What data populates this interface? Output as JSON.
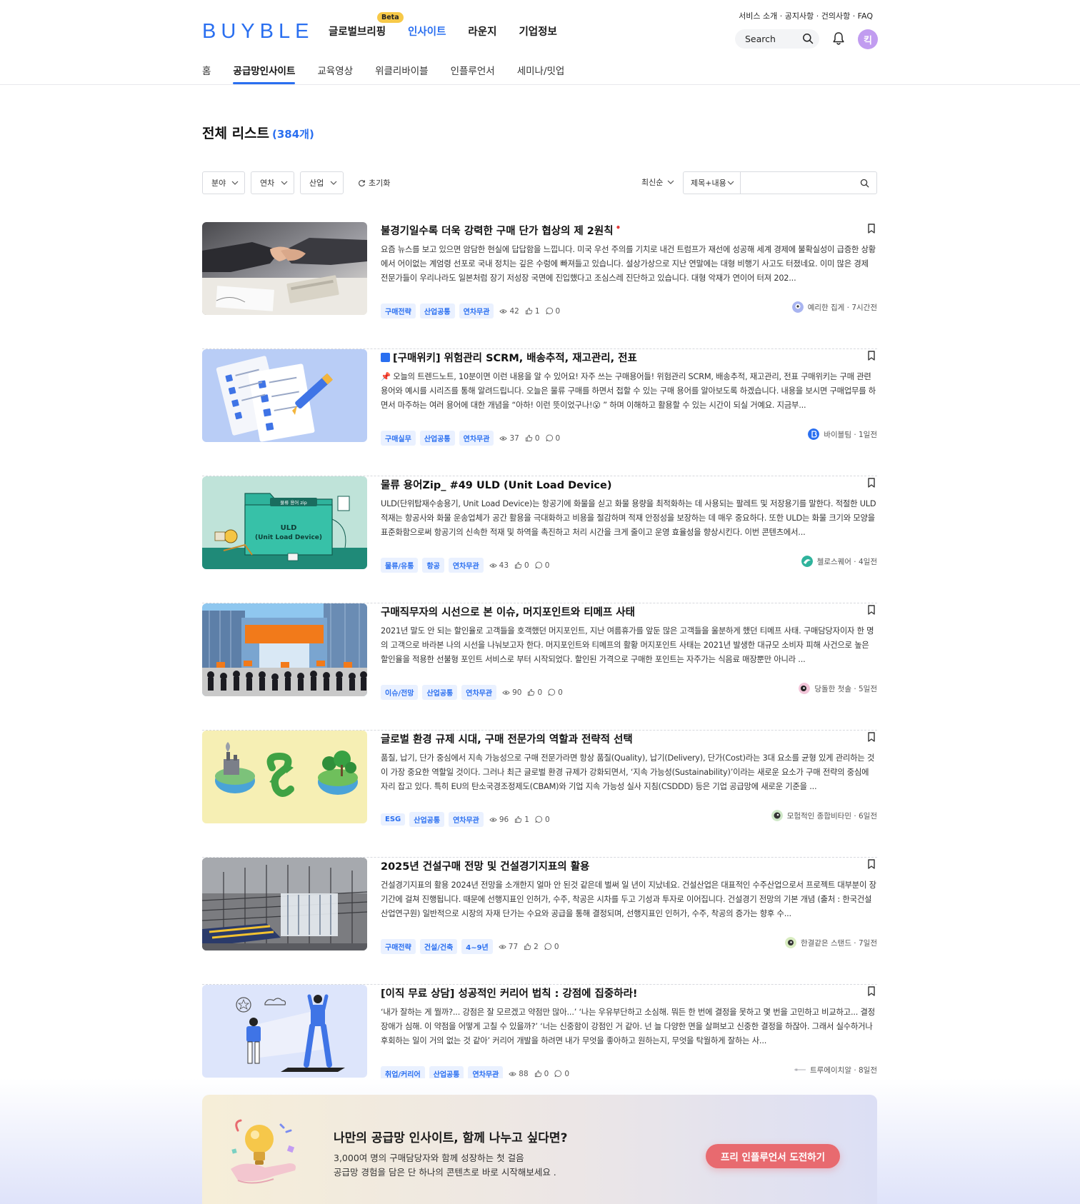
{
  "header": {
    "logo": "BUYBLE",
    "nav": [
      {
        "label": "글로벌브리핑",
        "badge": "Beta"
      },
      {
        "label": "인사이트",
        "active": true
      },
      {
        "label": "라운지"
      },
      {
        "label": "기업정보"
      }
    ],
    "util_links": "서비스 소개 · 공지사항 · 건의사항 · FAQ",
    "search_label": "Search",
    "avatar_initial": "킥",
    "subnav": [
      {
        "label": "홈"
      },
      {
        "label": "공급망인사이트",
        "active": true
      },
      {
        "label": "교육영상"
      },
      {
        "label": "위클리바이블"
      },
      {
        "label": "인플루언서"
      },
      {
        "label": "세미나/밋업"
      }
    ]
  },
  "list": {
    "title": "전체 리스트",
    "count": "(384개)"
  },
  "filters": {
    "field": "분야",
    "year": "연차",
    "industry": "산업",
    "reset": "초기화",
    "sort": "최신순",
    "scope": "제목+내용",
    "query_value": ""
  },
  "articles": [
    {
      "title": "불경기일수록 더욱 강력한 구매 단가 협상의 제 2원칙",
      "is_new": true,
      "new_mark": "•",
      "excerpt": "요즘 뉴스를 보고 있으면 암담한 현실에 답답함을 느낍니다. 미국 우선 주의를 기치로 내건 트럼프가 재선에 성공해 세계 경제에 불확실성이 급증한 상황에서 어이없는 계엄령 선포로 국내 정치는 깊은 수렁에 빠져들고 있습니다. 설상가상으로 지난 연말에는 대형 비행기 사고도 터졌네요. 이미 많은 경제 전문가들이 우리나라도 일본처럼 장기 저성장 국면에 진입했다고 조심스레 진단하고 있습니다. 대형 악재가 연이어 터져 202...",
      "tags": [
        "구매전략",
        "산업공통",
        "연차무관"
      ],
      "views": "42",
      "likes": "1",
      "comments": "0",
      "author": "예리한 집게 · 7시간전",
      "thumb": "handshake"
    },
    {
      "title": "[구매위키] 위험관리 SCRM, 배송추적, 재고관리, 전표",
      "book_icon": true,
      "excerpt": "📌 오늘의 트렌드노트, 10분이면 이런 내용을 알 수 있어요! 자주 쓰는 구매용어들! 위험관리 SCRM, 배송추적, 재고관리, 전표 구매위키는 구매 관련 용어와 예시를 시리즈를 통해 알려드립니다. 오늘은 물류 구매를 하면서 접할 수 있는 구매 용어를 알아보도록 하겠습니다. 내용을 보시면 구매업무를 하면서 마주하는 여러 용어에 대한 개념을 “아하! 이런 뜻이었구나!😮 ” 하며 이해하고 활용할 수 있는 시간이 되실 거예요. 지금부...",
      "tags": [
        "구매실무",
        "산업공통",
        "연차무관"
      ],
      "views": "37",
      "likes": "0",
      "comments": "0",
      "author": "바이블팀 · 1일전",
      "thumb": "checklist"
    },
    {
      "title": "물류 용어Zip_ #49 ULD (Unit Load Device)",
      "excerpt": "ULD(단위탑재수송용기, Unit Load Device)는 항공기에 화물을 싣고 화물 용량을 최적화하는 데 사용되는 팔레트 및 저장용기를 말한다. 적절한 ULD 적재는 항공사와 화물 운송업체가 공간 활용을 극대화하고 비용을 절감하며 적재 안정성을 보장하는 데 매우 중요하다. 또한 ULD는 화물 크기와 모양을 표준화함으로써 항공기의 신속한 적재 및 하역을 촉진하고 처리 시간을 크게 줄이고 운영 효율성을 향상시킨다. 이번 콘텐츠에서...",
      "tags": [
        "물류/유통",
        "항공",
        "연차무관"
      ],
      "views": "43",
      "likes": "0",
      "comments": "0",
      "author": "첼로스퀘어 · 4일전",
      "thumb": "uld",
      "thumb_text": [
        "ULD",
        "(Unit Load Device)"
      ],
      "thumb_folder_label": "물류 용어 zip"
    },
    {
      "title": "구매직무자의 시선으로 본 이슈, 머지포인트와 티메프 사태",
      "excerpt": "2021년 말도 안 되는 할인율로 고객들을 호객했던 머지포인트, 지난 여름휴가를 앞둔 많은 고객들을 울분하게 했던 티메프 사태. 구매담당자이자 한 명의 고객으로 바라본 나의 시선을 나눠보고자 한다. 머지포인트와 티메프의 활황 머지포인트 사태는 2021년 발생한 대규모 소비자 피해 사건으로 높은 할인율을 적용한 선불형 포인트 서비스로 부터 시작되었다. 할인된 가격으로 구매한 포인트는 자주가는 식음료 매장뿐만 아니라 ...",
      "tags": [
        "이슈/전망",
        "산업공통",
        "연차무관"
      ],
      "views": "90",
      "likes": "0",
      "comments": "0",
      "author": "당돌한 첫솔 · 5일전",
      "thumb": "crowd"
    },
    {
      "title": "글로벌 환경 규제 시대, 구매 전문가의 역할과 전략적 선택",
      "excerpt": "품질, 납기, 단가 중심에서 지속 가능성으로 구매 전문가라면 항상 품질(Quality), 납기(Delivery), 단가(Cost)라는 3대 요소를 균형 있게 관리하는 것이 가장 중요한 역할일 것이다. 그러나 최근 글로벌 환경 규제가 강화되면서, ‘지속 가능성(Sustainability)’이라는 새로운 요소가 구매 전략의 중심에 자리 잡고 있다. 특히 EU의 탄소국경조정제도(CBAM)와 기업 지속 가능성 실사 지침(CSDDD) 등은 기업 공급망에 새로운 기준을 ...",
      "tags": [
        "ESG",
        "산업공통",
        "연차무관"
      ],
      "views": "96",
      "likes": "1",
      "comments": "0",
      "author": "모험적인 종합비타민 · 6일전",
      "thumb": "eco"
    },
    {
      "title": "2025년 건설구매 전망 및 건설경기지표의 활용",
      "excerpt": "건설경기지표의 활용 2024년 전망을 소개한지 얼마 안 된것 같은데 벌써 일 년이 지났네요. 건설산업은 대표적인 수주산업으로서 프로젝트 대부분이 장기간에 걸쳐 진행됩니다. 때문에 선행지표인 인허가, 수주, 착공은 시차를 두고 기성과 투자로 이어집니다. 건설경기 전망의 기본 개념 (출처 : 한국건설산업연구원) 일반적으로 시장의 자재 단가는 수요와 공급을 통해 결정되며, 선행지표인 인허가, 수주, 착공의 증가는 향후 수...",
      "tags": [
        "구매전략",
        "건설/건축",
        "4~9년"
      ],
      "views": "77",
      "likes": "2",
      "comments": "0",
      "author": "한결같은 스탠드 · 7일전",
      "thumb": "construction"
    },
    {
      "title": "[이직 무료 상담] 성공적인 커리어 법칙 : 강점에 집중하라!",
      "excerpt": "‘내가 잘하는 게 뭘까?... 강점은 잘 모르겠고 약점만 많아...’ ‘나는 우유부단하고 소심해. 뭐든 한 번에 결정을 못하고 몇 번을 고민하고 비교하고... 결정장애가 심해. 이 약점을 어떻게 고칠 수 있을까?’ ‘너는 신중함이 강점인 거 같아. 넌 늘 다양한 면을 살펴보고 신중한 결정을 하잖아. 그래서 실수하거나 후회하는 일이 거의 없는 것 같아’ 커리어 개발을 하려면 내가 무엇을 좋아하고 원하는지, 무엇을 탁월하게 잘하는 사...",
      "tags": [
        "취업/커리어",
        "산업공통",
        "연차무관"
      ],
      "views": "88",
      "likes": "0",
      "comments": "0",
      "author": "트루에이치알 · 8일전",
      "thumb": "career"
    }
  ],
  "banner": {
    "title": "나만의 공급망 인사이트, 함께 나누고 싶다면?",
    "sub1": "3,000여 명의 구매담당자와 함께 성장하는 첫 걸음",
    "sub2": "공급망 경험을 담은 단 하나의 콘텐츠로 바로 시작해보세요 .",
    "button": "프리 인플루언서 도전하기"
  },
  "colors": {
    "brand": "#2a6ff0",
    "tag_bg": "#eaf1ff",
    "banner_button": "#e86a6f",
    "new_dot": "#e23b3b"
  }
}
